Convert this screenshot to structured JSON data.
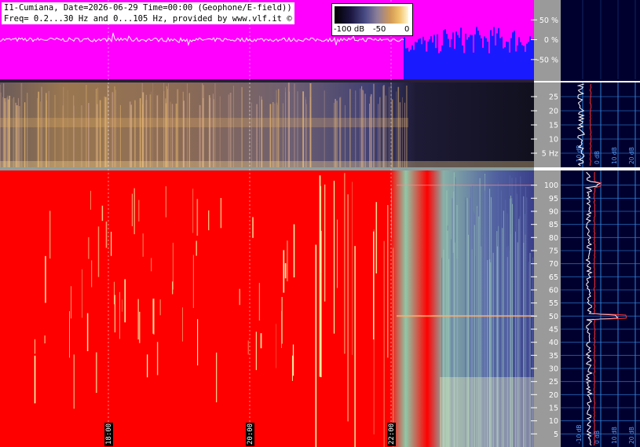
{
  "header": {
    "line1": "I1-Cumiana, Date=2026-06-29 Time=00:00 (Geophone/E-field))",
    "line2": "Freq= 0.2...30 Hz and 0...105 Hz, provided by www.vlf.it ©"
  },
  "colorbar": {
    "labels": [
      "-100 dB",
      "-50",
      "0"
    ]
  },
  "colors": {
    "waveform_bg": "#ff00ff",
    "spec_hi_bg": "#ff0000",
    "panel_bg": "#00002e",
    "grid": "#2f7fd8",
    "axis_bg": "#9a9a9a"
  },
  "chart_data": [
    {
      "type": "line",
      "panel": "waveform",
      "ylim": [
        -100,
        100
      ],
      "y_ticks": [
        "50 %",
        "0 %",
        "-50 %"
      ]
    },
    {
      "type": "heatmap",
      "panel": "spectrogram-low",
      "ylim": [
        0,
        30
      ],
      "y_ticks": [
        "25",
        "20",
        "15",
        "10",
        "5 Hz"
      ]
    },
    {
      "type": "heatmap",
      "panel": "spectrogram-high",
      "ylim": [
        0,
        105
      ],
      "y_ticks": [
        "100",
        "95",
        "90",
        "85",
        "80",
        "75",
        "70",
        "65",
        "60",
        "55",
        "50",
        "45",
        "40",
        "35",
        "30",
        "25",
        "20",
        "15",
        "10",
        "5"
      ],
      "x_ticks": [
        "18:00",
        "20:00",
        "22:00"
      ]
    },
    {
      "type": "line",
      "panel": "spectrum-low",
      "x_ticks": [
        "-10 dB",
        "0 dB",
        "10 dB",
        "20 dB"
      ]
    },
    {
      "type": "line",
      "panel": "spectrum-high",
      "x_ticks": [
        "-10 dB",
        "0 dB",
        "10 dB",
        "20 dB"
      ]
    }
  ]
}
